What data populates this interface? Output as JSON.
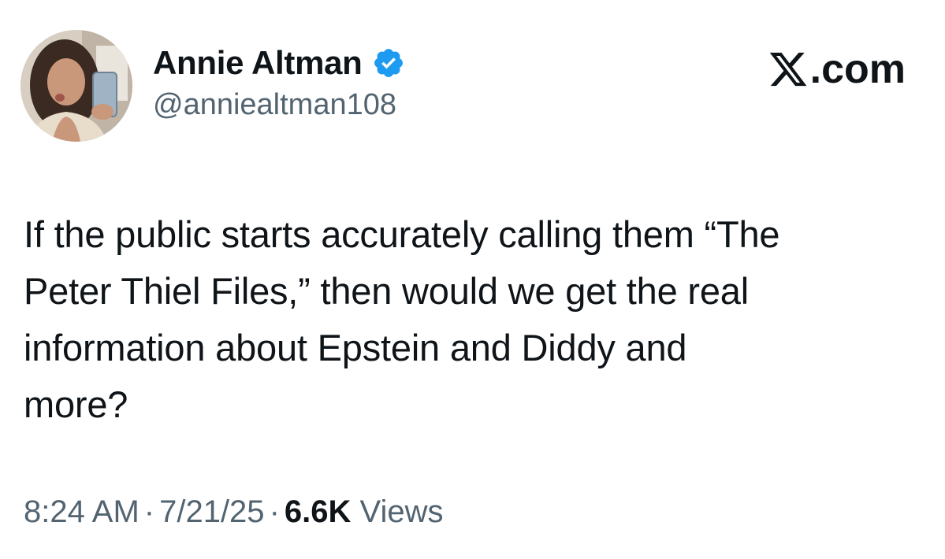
{
  "tweet": {
    "author": {
      "display_name": "Annie Altman",
      "handle": "@anniealtman108",
      "verified": true,
      "avatar_icon": "profile-photo"
    },
    "source": {
      "label": ".com",
      "logo_icon": "x-logo-icon"
    },
    "text_lines": [
      "If the public starts accurately calling them “The",
      "Peter Thiel Files,” then would we get the real",
      "information about Epstein and Diddy and",
      "more?"
    ],
    "meta": {
      "time": "8:24 AM",
      "separator": "·",
      "date": "7/21/25",
      "views_count": "6.6K",
      "views_label": "Views"
    },
    "colors": {
      "text_primary": "#0f1419",
      "text_secondary": "#536471",
      "verified_badge": "#1d9bf0"
    }
  }
}
